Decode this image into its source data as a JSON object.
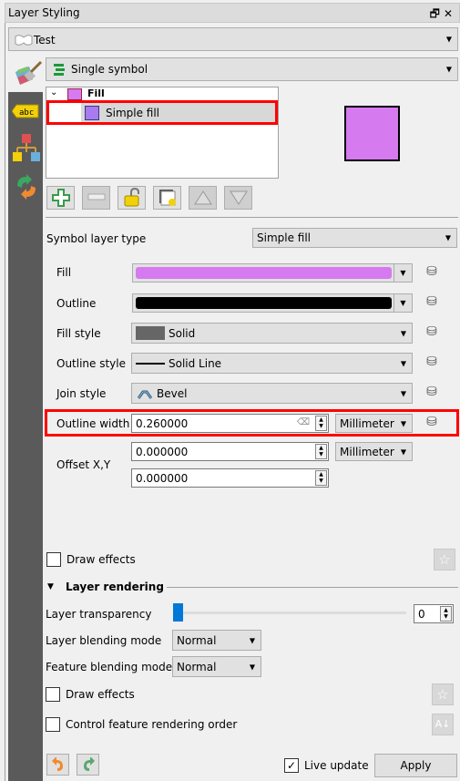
{
  "window": {
    "title": "Layer Styling",
    "float_icon": "restore-icon",
    "close_icon": "close-icon"
  },
  "layer_select": {
    "value": "Test",
    "icon": "polygon-layer-icon"
  },
  "renderer_select": {
    "value": "Single symbol",
    "icon": "single-symbol-icon"
  },
  "sidebar": {
    "items": [
      {
        "name": "symbology",
        "icon": "paintbrush-icon"
      },
      {
        "name": "labels",
        "icon": "abc-label-icon"
      },
      {
        "name": "diagrams",
        "icon": "diagram-icon"
      },
      {
        "name": "history",
        "icon": "history-icon"
      }
    ]
  },
  "symbol_tree": {
    "root": {
      "label": "Fill",
      "color": "#d67af0"
    },
    "child": {
      "label": "Simple fill",
      "color": "#a97af0"
    }
  },
  "preview": {
    "fill": "#d67af0",
    "outline": "#000000"
  },
  "tree_toolbar": [
    {
      "name": "add-layer-button",
      "icon": "plus-icon",
      "enabled": true
    },
    {
      "name": "remove-layer-button",
      "icon": "minus-icon",
      "enabled": false
    },
    {
      "name": "lock-layer-button",
      "icon": "lock-open-icon",
      "enabled": true
    },
    {
      "name": "duplicate-layer-button",
      "icon": "duplicate-icon",
      "enabled": true
    },
    {
      "name": "move-up-button",
      "icon": "arrow-up-icon",
      "enabled": false
    },
    {
      "name": "move-down-button",
      "icon": "arrow-down-icon",
      "enabled": false
    }
  ],
  "symbol_layer_type": {
    "label": "Symbol layer type",
    "value": "Simple fill"
  },
  "props": {
    "fill": {
      "label": "Fill",
      "color": "#d67af0"
    },
    "outline": {
      "label": "Outline",
      "color": "#000000"
    },
    "fill_style": {
      "label": "Fill style",
      "value": "Solid"
    },
    "outline_style": {
      "label": "Outline style",
      "value": "Solid Line"
    },
    "join_style": {
      "label": "Join style",
      "value": "Bevel"
    },
    "outline_width": {
      "label": "Outline width",
      "value": "0.260000",
      "unit": "Millimeter"
    },
    "offset": {
      "label": "Offset X,Y",
      "x": "0.000000",
      "y": "0.000000",
      "unit": "Millimeter"
    }
  },
  "draw_effects_1": {
    "label": "Draw effects",
    "checked": false
  },
  "layer_rendering": {
    "title": "Layer rendering",
    "transparency": {
      "label": "Layer transparency",
      "value": "0",
      "fraction": 0
    },
    "layer_blending": {
      "label": "Layer blending mode",
      "value": "Normal"
    },
    "feature_blending": {
      "label": "Feature blending mode",
      "value": "Normal"
    },
    "draw_effects": {
      "label": "Draw effects",
      "checked": false
    },
    "control_order": {
      "label": "Control feature rendering order",
      "checked": false
    }
  },
  "footer": {
    "live_update": {
      "label": "Live update",
      "checked": true
    },
    "apply": "Apply"
  }
}
